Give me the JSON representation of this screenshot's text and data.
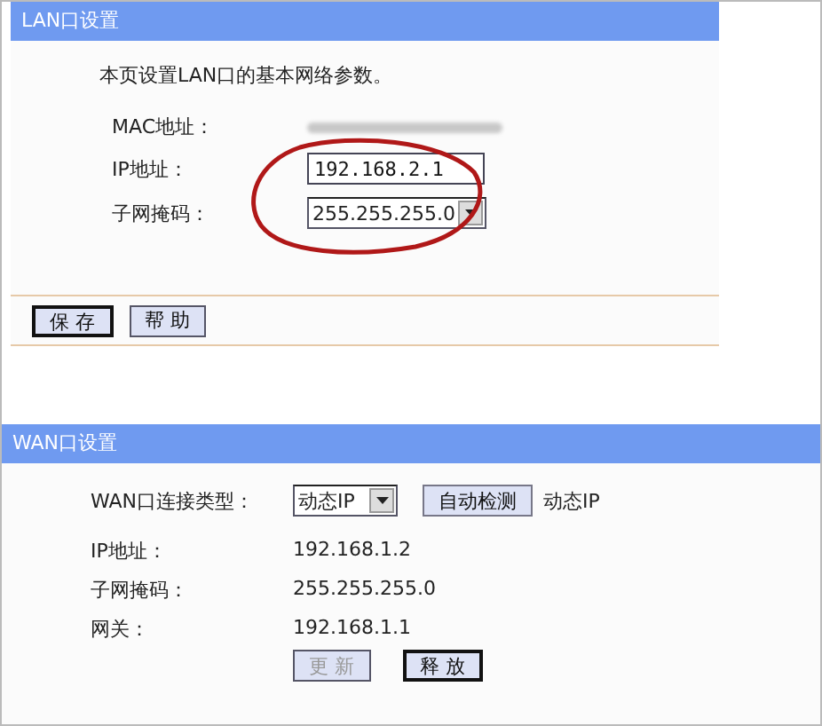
{
  "lan": {
    "title": "LAN口设置",
    "intro": "本页设置LAN口的基本网络参数。",
    "mac": {
      "label": "MAC地址："
    },
    "ip": {
      "label": "IP地址：",
      "value": "192.168.2.1"
    },
    "mask": {
      "label": "子网掩码：",
      "value": "255.255.255.0"
    },
    "buttons": [
      {
        "label": "保 存",
        "default": true
      },
      {
        "label": "帮 助",
        "default": false
      }
    ]
  },
  "wan": {
    "title": "WAN口设置",
    "type": {
      "label": "WAN口连接类型：",
      "value": "动态IP",
      "detect": "自动检测",
      "result": "动态IP"
    },
    "rows": [
      {
        "label": "IP地址：",
        "value": "192.168.1.2"
      },
      {
        "label": "子网掩码：",
        "value": "255.255.255.0"
      },
      {
        "label": "网关：",
        "value": "192.168.1.1"
      }
    ],
    "buttons": [
      {
        "label": "更 新",
        "disabled": true
      },
      {
        "label": "释 放",
        "disabled": false
      }
    ]
  }
}
